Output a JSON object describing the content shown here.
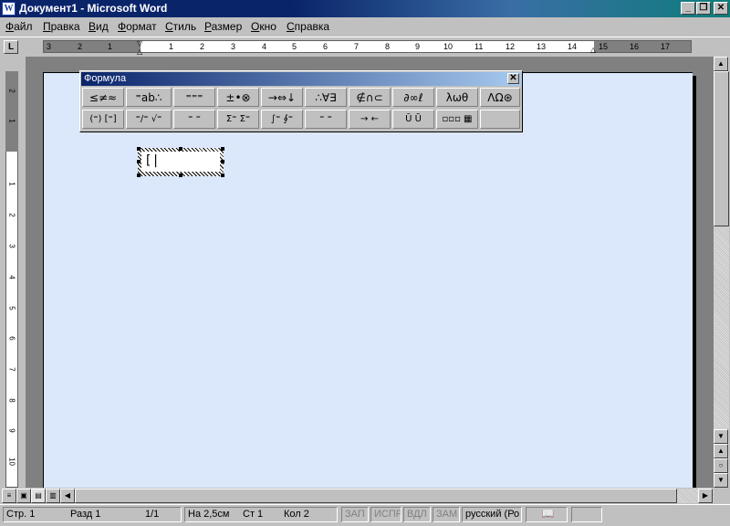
{
  "window": {
    "title": "Документ1 - Microsoft Word",
    "icon_letter": "W",
    "controls": {
      "minimize": "_",
      "restore": "❐",
      "close": "✕"
    }
  },
  "menu": [
    "Файл",
    "Правка",
    "Вид",
    "Формат",
    "Стиль",
    "Размер",
    "Окно",
    "Справка"
  ],
  "ruler": {
    "tab_selector": "L",
    "h_numbers": [
      "3",
      "2",
      "1",
      "1",
      "2",
      "3",
      "4",
      "5",
      "6",
      "7",
      "8",
      "9",
      "10",
      "11",
      "12",
      "13",
      "14",
      "15",
      "16",
      "17"
    ],
    "v_numbers": [
      "2",
      "1",
      "1",
      "2",
      "3",
      "4",
      "5",
      "6",
      "7",
      "8",
      "9",
      "10"
    ]
  },
  "formula_toolbar": {
    "title": "Формула",
    "close": "✕",
    "row1": [
      "≤≠≈",
      "⁼ab∴",
      "⁼⁼⁼",
      "±•⊗",
      "→⇔↓",
      "∴∀∃",
      "∉∩⊂",
      "∂∞ℓ",
      "λωθ",
      "ΛΩ⊛"
    ],
    "row2": [
      "(⁼) [⁼]",
      "⁼/⁼ √⁼",
      "⁼ ⁼",
      "Σ⁼ Σ⁼",
      "∫⁼ ∮⁼",
      "⁼ ⁼",
      "→ ←",
      "Ū Ũ",
      "▫▫▫ ▦",
      ""
    ]
  },
  "equation": {
    "caret": "[|"
  },
  "scroll": {
    "up": "▲",
    "down": "▼",
    "prev": "▲",
    "next": "▼",
    "select": "○",
    "left": "◀",
    "right": "▶"
  },
  "view_buttons": [
    "≡",
    "▣",
    "▤",
    "▥"
  ],
  "status": {
    "page": "Стр. 1",
    "section": "Разд 1",
    "pages": "1/1",
    "at": "На 2,5см",
    "line": "Ст 1",
    "col": "Кол 2",
    "rec": "ЗАП",
    "trk": "ИСПР",
    "ext": "ВДЛ",
    "ovr": "ЗАМ",
    "lang": "русский (Ро",
    "book_icon": "📖"
  }
}
